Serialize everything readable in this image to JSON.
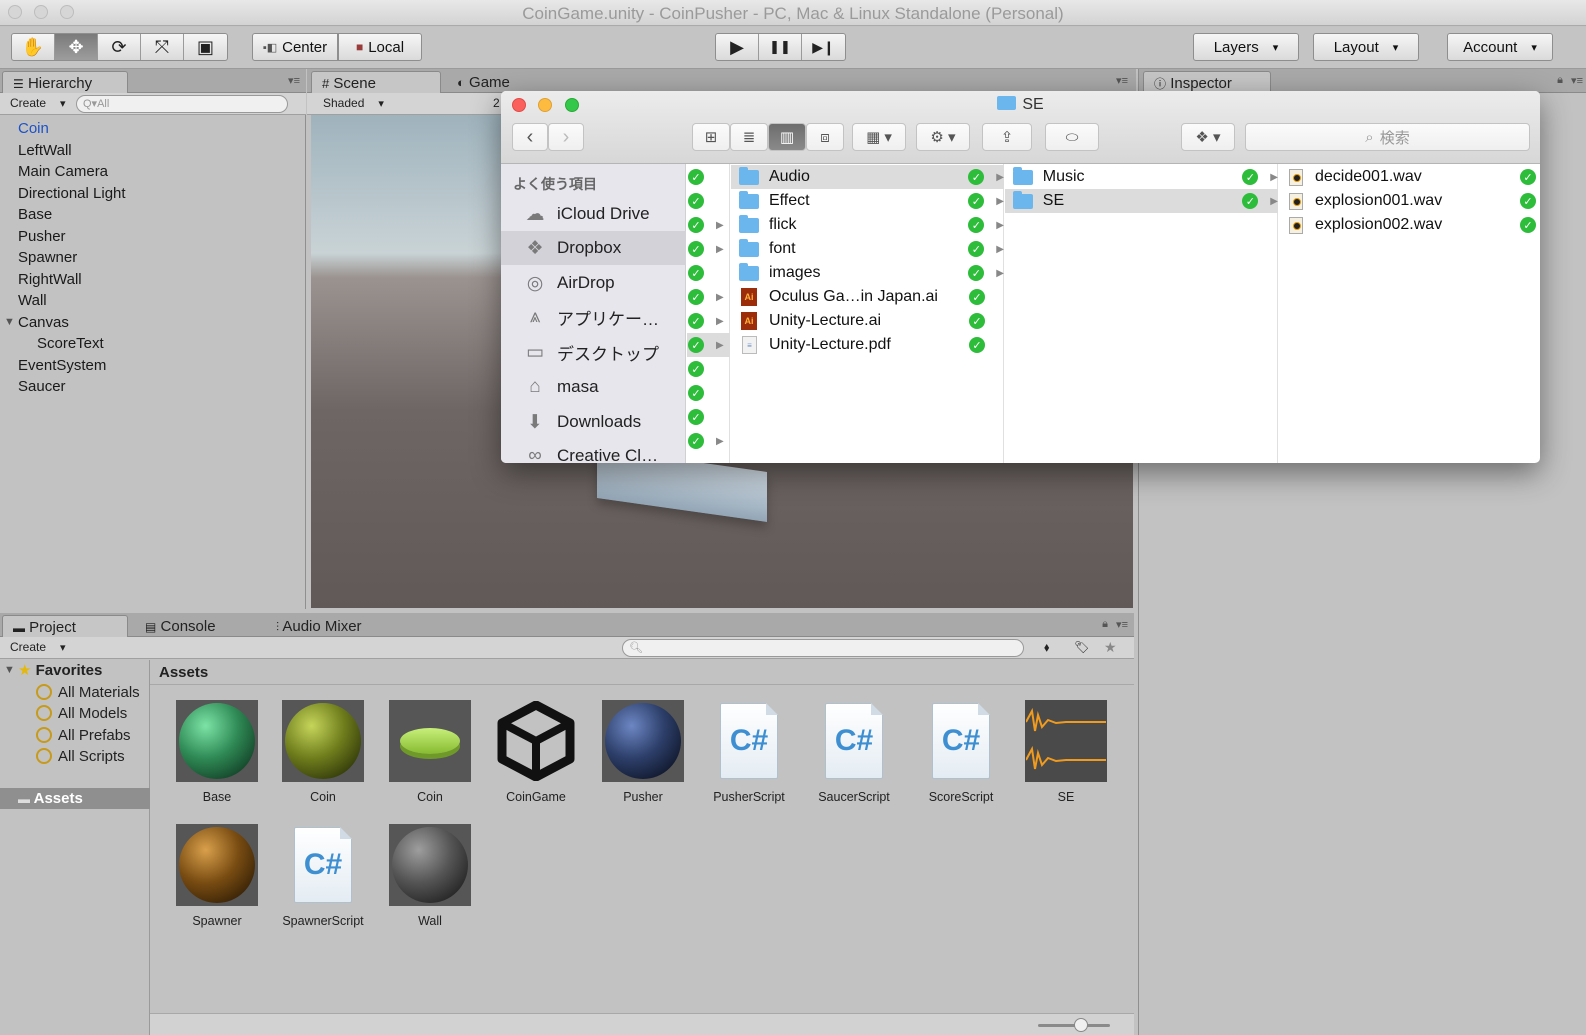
{
  "window": {
    "title": "CoinGame.unity - CoinPusher - PC, Mac & Linux Standalone (Personal)"
  },
  "toolbar": {
    "tools": [
      "hand-icon",
      "move-icon",
      "rotate-icon",
      "scale-icon",
      "rect-icon"
    ],
    "pivot_label": "Center",
    "space_label": "Local",
    "play_icon": "▶",
    "pause_icon": "❚❚",
    "step_icon": "▶❙",
    "layers_label": "Layers",
    "layout_label": "Layout",
    "account_label": "Account"
  },
  "hierarchy": {
    "tab_label": "Hierarchy",
    "create_label": "Create",
    "search_placeholder": "Q▾All",
    "items": [
      {
        "label": "Coin",
        "selected": true
      },
      {
        "label": "LeftWall"
      },
      {
        "label": "Main Camera"
      },
      {
        "label": "Directional Light"
      },
      {
        "label": "Base"
      },
      {
        "label": "Pusher"
      },
      {
        "label": "Spawner"
      },
      {
        "label": "RightWall"
      },
      {
        "label": "Wall"
      },
      {
        "label": "Canvas",
        "expanded": true
      },
      {
        "label": "ScoreText",
        "child": true
      },
      {
        "label": "EventSystem"
      },
      {
        "label": "Saucer"
      }
    ]
  },
  "scene": {
    "tab_scene": "Scene",
    "tab_game": "Game",
    "shading_mode": "Shaded",
    "twod_label": "2"
  },
  "inspector": {
    "tab_label": "Inspector"
  },
  "project": {
    "tab_project": "Project",
    "tab_console": "Console",
    "tab_mixer": "Audio Mixer",
    "create_label": "Create",
    "favorites_label": "Favorites",
    "favorites": [
      "All Materials",
      "All Models",
      "All Prefabs",
      "All Scripts"
    ],
    "assets_folder": "Assets",
    "assets_header": "Assets",
    "assets": [
      {
        "label": "Base",
        "kind": "sphere",
        "color": "#2f8a55"
      },
      {
        "label": "Coin",
        "kind": "sphere",
        "color": "#6f7d1c"
      },
      {
        "label": "Coin",
        "kind": "coin",
        "color": "#a6d84a"
      },
      {
        "label": "CoinGame",
        "kind": "unity"
      },
      {
        "label": "Pusher",
        "kind": "sphere",
        "color": "#2d3f6a"
      },
      {
        "label": "PusherScript",
        "kind": "script"
      },
      {
        "label": "SaucerScript",
        "kind": "script"
      },
      {
        "label": "ScoreScript",
        "kind": "script"
      },
      {
        "label": "SE",
        "kind": "audio"
      },
      {
        "label": "Spawner",
        "kind": "sphere",
        "color": "#7a4d12"
      },
      {
        "label": "SpawnerScript",
        "kind": "script"
      },
      {
        "label": "Wall",
        "kind": "sphere",
        "color": "#555555"
      }
    ]
  },
  "finder": {
    "title": "SE",
    "search_placeholder": "検索",
    "sidebar_header": "よく使う項目",
    "sidebar": [
      {
        "label": "iCloud Drive",
        "icon": "cloud-icon"
      },
      {
        "label": "Dropbox",
        "icon": "dropbox-icon",
        "selected": true
      },
      {
        "label": "AirDrop",
        "icon": "airdrop-icon"
      },
      {
        "label": "アプリケー…",
        "icon": "applications-icon"
      },
      {
        "label": "デスクトップ",
        "icon": "desktop-icon"
      },
      {
        "label": "masa",
        "icon": "home-icon"
      },
      {
        "label": "Downloads",
        "icon": "downloads-icon"
      },
      {
        "label": "Creative Cl…",
        "icon": "creative-cloud-icon"
      }
    ],
    "column2": [
      {
        "label": "Audio",
        "type": "folder",
        "selected": true
      },
      {
        "label": "Effect",
        "type": "folder"
      },
      {
        "label": "flick",
        "type": "folder"
      },
      {
        "label": "font",
        "type": "folder"
      },
      {
        "label": "images",
        "type": "folder"
      },
      {
        "label": "Oculus Ga…in Japan.ai",
        "type": "ai"
      },
      {
        "label": "Unity-Lecture.ai",
        "type": "ai"
      },
      {
        "label": "Unity-Lecture.pdf",
        "type": "pdf"
      }
    ],
    "column3": [
      {
        "label": "Music",
        "type": "folder"
      },
      {
        "label": "SE",
        "type": "folder",
        "selected": true
      }
    ],
    "column4": [
      {
        "label": "decide001.wav",
        "type": "wav"
      },
      {
        "label": "explosion001.wav",
        "type": "wav"
      },
      {
        "label": "explosion002.wav",
        "type": "wav"
      }
    ]
  }
}
